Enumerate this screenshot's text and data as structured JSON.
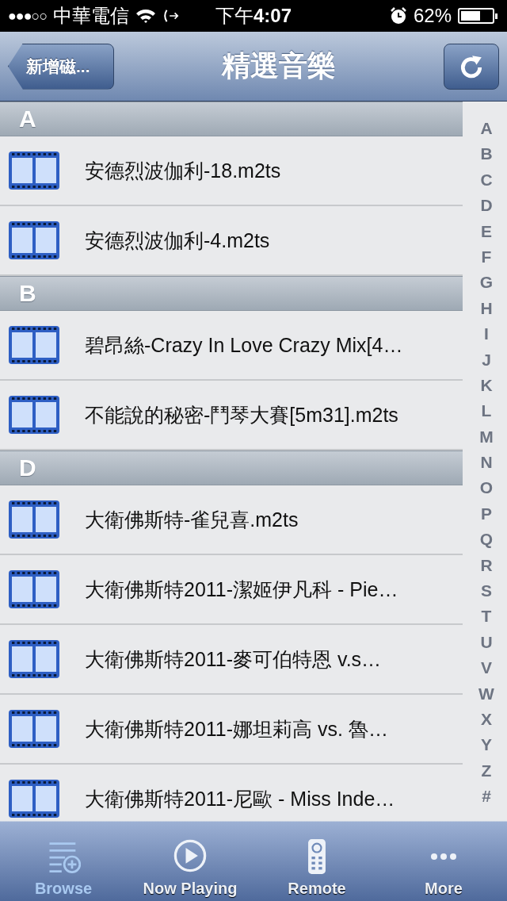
{
  "status_bar": {
    "signal": "●●●○○",
    "carrier": "中華電信",
    "time": "下午**4:07**",
    "battery": "62%"
  },
  "nav_bar": {
    "back_button": "新增磁...",
    "title": "精選音樂"
  },
  "sections": [
    {
      "letter": "A",
      "items": [
        {
          "title": "安德烈波伽利-18.m2ts"
        },
        {
          "title": "安德烈波伽利-4.m2ts"
        }
      ]
    },
    {
      "letter": "B",
      "items": [
        {
          "title": "碧昂絲-Crazy In Love Crazy Mix[4…"
        },
        {
          "title": "不能說的秘密-鬥琴大賽[5m31].m2ts"
        }
      ]
    },
    {
      "letter": "D",
      "items": [
        {
          "title": "大衛佛斯特-雀兒喜.m2ts"
        },
        {
          "title": "大衛佛斯特2011-潔姬伊凡科 - Pie…"
        },
        {
          "title": "大衛佛斯特2011-麥可伯特恩 v.s…"
        },
        {
          "title": "大衛佛斯特2011-娜坦莉高 vs. 魯…"
        },
        {
          "title": "大衛佛斯特2011-尼歐 - Miss Inde…"
        }
      ]
    }
  ],
  "index": [
    "A",
    "B",
    "C",
    "D",
    "E",
    "F",
    "G",
    "H",
    "I",
    "J",
    "K",
    "L",
    "M",
    "N",
    "O",
    "P",
    "Q",
    "R",
    "S",
    "T",
    "U",
    "V",
    "W",
    "X",
    "Y",
    "Z",
    "#"
  ],
  "tabs": [
    {
      "label": "Browse",
      "kind": "browse",
      "selected": true
    },
    {
      "label": "Now Playing",
      "kind": "play",
      "selected": false
    },
    {
      "label": "Remote",
      "kind": "remote",
      "selected": false
    },
    {
      "label": "More",
      "kind": "more",
      "selected": false
    }
  ]
}
